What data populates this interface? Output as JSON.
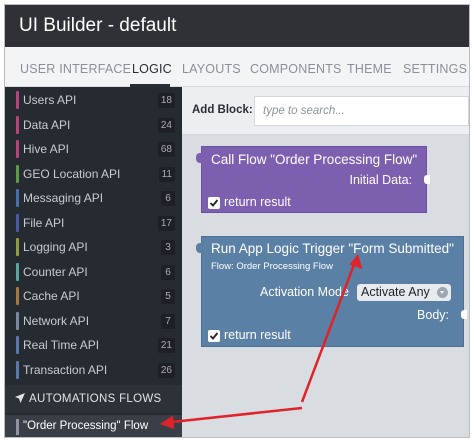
{
  "app": {
    "title": "UI Builder - default"
  },
  "tabs": [
    {
      "label": "USER INTERFACE",
      "active": false
    },
    {
      "label": "LOGIC",
      "active": true
    },
    {
      "label": "LAYOUTS",
      "active": false
    },
    {
      "label": "COMPONENTS",
      "active": false
    },
    {
      "label": "THEME",
      "active": false
    },
    {
      "label": "SETTINGS",
      "active": false
    }
  ],
  "sidebar": {
    "items": [
      {
        "label": "Users API",
        "count": "18",
        "color": "#b0477a"
      },
      {
        "label": "Data API",
        "count": "24",
        "color": "#b0477a"
      },
      {
        "label": "Hive API",
        "count": "68",
        "color": "#b0477a"
      },
      {
        "label": "GEO Location API",
        "count": "11",
        "color": "#5c9a4a"
      },
      {
        "label": "Messaging API",
        "count": "6",
        "color": "#4a6ea8"
      },
      {
        "label": "File API",
        "count": "17",
        "color": "#4a5aa0"
      },
      {
        "label": "Logging API",
        "count": "3",
        "color": "#8f9b45"
      },
      {
        "label": "Counter API",
        "count": "6",
        "color": "#5aa5a0"
      },
      {
        "label": "Cache API",
        "count": "5",
        "color": "#a07a45"
      },
      {
        "label": "Network API",
        "count": "7",
        "color": "#7a8a9c"
      },
      {
        "label": "Real Time API",
        "count": "21",
        "color": "#5c78a8"
      },
      {
        "label": "Transaction API",
        "count": "26",
        "color": "#5c78a8"
      }
    ],
    "automations_header": "AUTOMATIONS FLOWS",
    "flow_item": "\"Order Processing\" Flow"
  },
  "workspace": {
    "add_block_label": "Add Block:",
    "search_placeholder": "type to search..."
  },
  "blocks": {
    "call_flow": {
      "title": "Call Flow \"Order Processing Flow\"",
      "initial_data_label": "Initial Data:",
      "return_result_label": "return result",
      "return_result_checked": true
    },
    "trigger": {
      "title": "Run App Logic Trigger \"Form Submitted\"",
      "subtitle": "Flow: Order Processing Flow",
      "activation_label": "Activation Mode",
      "activation_value": "Activate Any",
      "body_label": "Body:",
      "return_result_label": "return result",
      "return_result_checked": true
    }
  },
  "colors": {
    "topbar": "#2f3136",
    "sidebar": "#262a31",
    "block_purple": "#7d5fb0",
    "block_blue": "#5b80a5",
    "annotation_arrow": "#e0222a"
  }
}
